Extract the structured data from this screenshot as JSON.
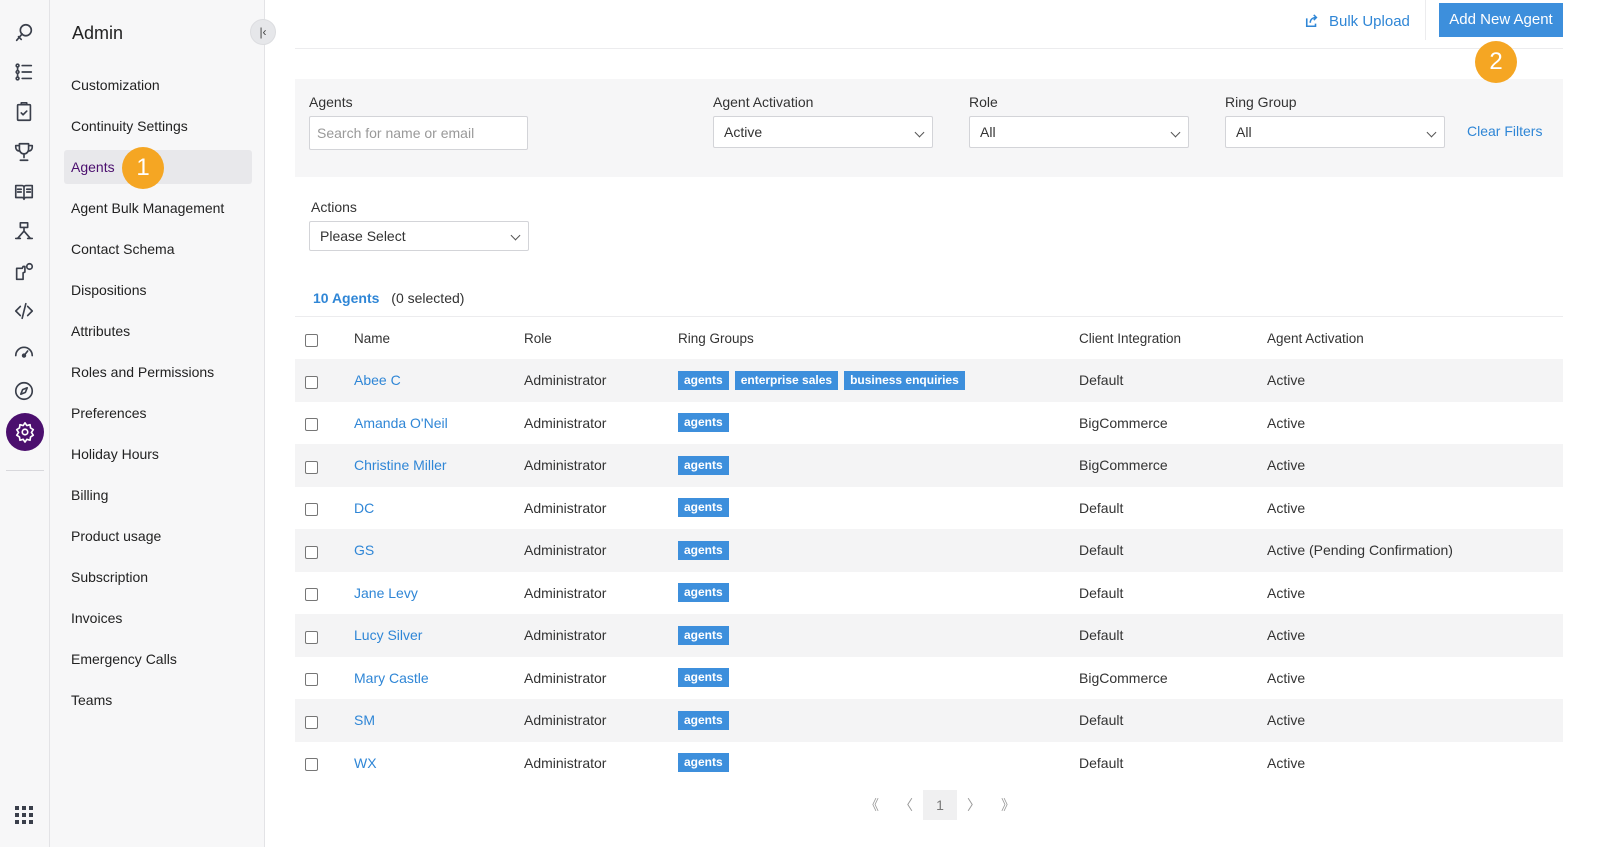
{
  "rail": {
    "icons": [
      "support-icon",
      "list-icon",
      "clipboard-icon",
      "trophy-icon",
      "book-icon",
      "flow-icon",
      "integrations-icon",
      "code-icon",
      "dashboard-icon",
      "compass-icon",
      "settings-icon"
    ],
    "active_icon": "settings-icon",
    "active_color": "#4b0f6e"
  },
  "sidebar": {
    "title": "Admin",
    "items": [
      {
        "label": "Customization"
      },
      {
        "label": "Continuity Settings"
      },
      {
        "label": "Agents",
        "active": true
      },
      {
        "label": "Agent Bulk Management"
      },
      {
        "label": "Contact Schema"
      },
      {
        "label": "Dispositions"
      },
      {
        "label": "Attributes"
      },
      {
        "label": "Roles and Permissions"
      },
      {
        "label": "Preferences"
      },
      {
        "label": "Holiday Hours"
      },
      {
        "label": "Billing"
      },
      {
        "label": "Product usage"
      },
      {
        "label": "Subscription"
      },
      {
        "label": "Invoices"
      },
      {
        "label": "Emergency Calls"
      },
      {
        "label": "Teams"
      }
    ]
  },
  "callouts": {
    "one": "1",
    "two": "2",
    "color": "#f5a623"
  },
  "header": {
    "bulk_upload": "Bulk Upload",
    "add_agent": "Add New Agent",
    "accent": "#3d8fdc"
  },
  "filters": {
    "agents_label": "Agents",
    "agents_placeholder": "Search for name or email",
    "activation_label": "Agent Activation",
    "activation_value": "Active",
    "role_label": "Role",
    "role_value": "All",
    "ring_group_label": "Ring Group",
    "ring_group_value": "All",
    "clear": "Clear Filters"
  },
  "actions": {
    "label": "Actions",
    "value": "Please Select"
  },
  "summary": {
    "count": "10 Agents",
    "selected": "(0 selected)"
  },
  "table": {
    "columns": [
      "Name",
      "Role",
      "Ring Groups",
      "Client Integration",
      "Agent Activation"
    ],
    "rows": [
      {
        "name": "Abee C",
        "role": "Administrator",
        "groups": [
          "agents",
          "enterprise sales",
          "business enquiries"
        ],
        "integration": "Default",
        "activation": "Active"
      },
      {
        "name": "Amanda O'Neil",
        "role": "Administrator",
        "groups": [
          "agents"
        ],
        "integration": "BigCommerce",
        "activation": "Active"
      },
      {
        "name": "Christine Miller",
        "role": "Administrator",
        "groups": [
          "agents"
        ],
        "integration": "BigCommerce",
        "activation": "Active"
      },
      {
        "name": "DC",
        "role": "Administrator",
        "groups": [
          "agents"
        ],
        "integration": "Default",
        "activation": "Active"
      },
      {
        "name": "GS",
        "role": "Administrator",
        "groups": [
          "agents"
        ],
        "integration": "Default",
        "activation": "Active (Pending Confirmation)"
      },
      {
        "name": "Jane Levy",
        "role": "Administrator",
        "groups": [
          "agents"
        ],
        "integration": "Default",
        "activation": "Active"
      },
      {
        "name": "Lucy Silver",
        "role": "Administrator",
        "groups": [
          "agents"
        ],
        "integration": "Default",
        "activation": "Active"
      },
      {
        "name": "Mary Castle",
        "role": "Administrator",
        "groups": [
          "agents"
        ],
        "integration": "BigCommerce",
        "activation": "Active"
      },
      {
        "name": "SM",
        "role": "Administrator",
        "groups": [
          "agents"
        ],
        "integration": "Default",
        "activation": "Active"
      },
      {
        "name": "WX",
        "role": "Administrator",
        "groups": [
          "agents"
        ],
        "integration": "Default",
        "activation": "Active"
      }
    ]
  },
  "pagination": {
    "first": "《",
    "prev": "〈",
    "current": "1",
    "next": "〉",
    "last": "》"
  }
}
